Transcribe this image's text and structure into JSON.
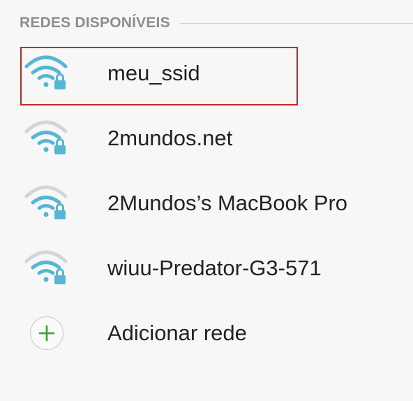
{
  "section": {
    "title": "REDES DISPONÍVEIS"
  },
  "networks": [
    {
      "ssid": "meu_ssid",
      "icon": "wifi-lock-icon",
      "signal": "full",
      "selected": true
    },
    {
      "ssid": "2mundos.net",
      "icon": "wifi-lock-icon",
      "signal": "medium",
      "selected": false
    },
    {
      "ssid": "2Mundos’s MacBook Pro",
      "icon": "wifi-lock-icon",
      "signal": "medium",
      "selected": false
    },
    {
      "ssid": "wiuu-Predator-G3-571",
      "icon": "wifi-lock-icon",
      "signal": "medium",
      "selected": false
    }
  ],
  "add_network": {
    "label": "Adicionar rede",
    "icon": "plus-icon"
  },
  "colors": {
    "wifi_active": "#55b7d1",
    "wifi_inactive": "#cfd7dc",
    "plus": "#43a047",
    "highlight_border": "#c62828",
    "text": "#222222",
    "section_title": "#8d8d8d"
  }
}
